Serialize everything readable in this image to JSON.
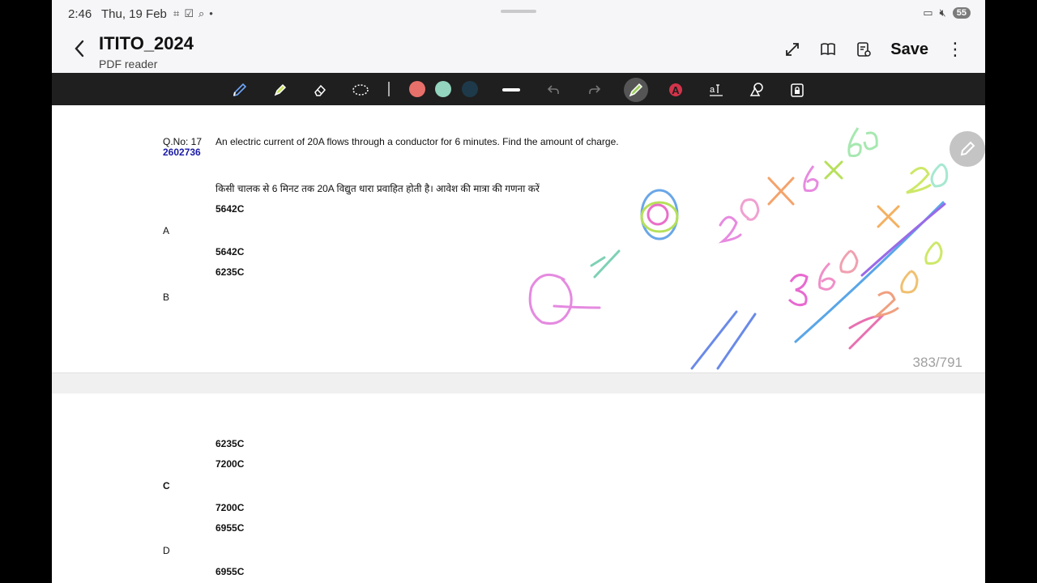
{
  "status_bar": {
    "time": "2:46",
    "date": "Thu, 19 Feb",
    "battery": "55"
  },
  "header": {
    "title": "ITITO_2024",
    "subtitle": "PDF reader",
    "save_label": "Save"
  },
  "toolbar": {
    "tools": [
      "pen-icon",
      "highlighter-icon",
      "eraser-icon",
      "lasso-icon",
      "color-coral",
      "color-mint",
      "color-navy",
      "stroke-width",
      "undo-icon",
      "redo-icon",
      "rainbow-pen-icon",
      "text-color-icon",
      "text-box-icon",
      "shapes-icon",
      "lock-icon"
    ],
    "colors": {
      "coral": "#e8706a",
      "mint": "#93d5bf",
      "navy": "#1e3a4a"
    }
  },
  "question": {
    "number_label": "Q.No: 17",
    "id": "2602736",
    "text_en": "An electric current of 20A flows through a conductor for 6 minutes. Find the amount of charge.",
    "text_hi": "किसी चालक से 6 मिनट तक 20A विद्युत धारा प्रवाहित होती है। आवेश की मात्रा की गणना करें",
    "options_top": [
      {
        "value_a1": "5642C",
        "letter": "A",
        "value_a2": "5642C"
      },
      {
        "value_b1": "6235C",
        "letter": "B"
      }
    ],
    "options_bottom": {
      "b2": "6235C",
      "c1": "7200C",
      "c_letter": "C",
      "c2": "7200C",
      "d1": "6955C",
      "d_letter": "D",
      "d2": "6955C"
    }
  },
  "page_indicator": "383/791"
}
